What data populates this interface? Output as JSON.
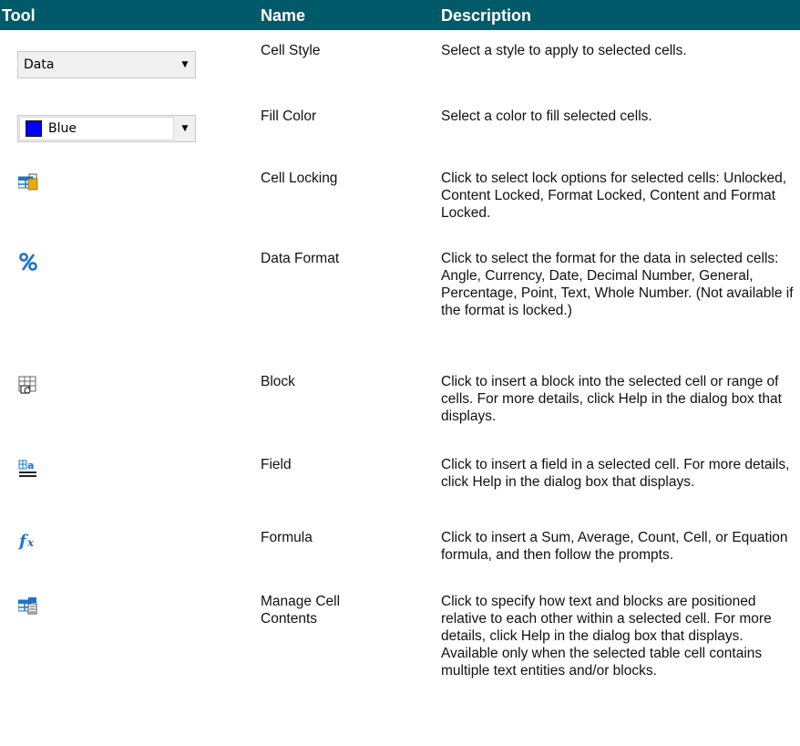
{
  "header": {
    "tool": "Tool",
    "name": "Name",
    "description": "Description"
  },
  "rows": [
    {
      "icon": "cell-style-dropdown",
      "dropdown_value": "Data",
      "name": "Cell Style",
      "description": "Select a style to apply to selected cells."
    },
    {
      "icon": "fill-color-dropdown",
      "dropdown_value": "Blue",
      "swatch_color": "#0000ff",
      "name": "Fill Color",
      "description": "Select a color to fill selected cells."
    },
    {
      "icon": "cell-locking-icon",
      "name": "Cell Locking",
      "description": "Click to select lock options for selected cells: Unlocked, Content Locked, Format Locked, Content and Format Locked."
    },
    {
      "icon": "percent-icon",
      "name": "Data Format",
      "description": "Click to select the format for the data in selected cells: Angle, Currency, Date, Decimal Number, General, Percentage, Point, Text, Whole Number. (Not available if the format is locked.)"
    },
    {
      "icon": "insert-block-icon",
      "name": "Block",
      "description": "Click to insert a block into the selected cell or range of cells. For more details, click Help in the dialog box that displays."
    },
    {
      "icon": "insert-field-icon",
      "name": "Field",
      "description": "Click to insert a field in a selected cell. For more details, click Help in the dialog box that displays."
    },
    {
      "icon": "formula-icon",
      "name": "Formula",
      "description": "Click to insert a Sum, Average, Count, Cell, or Equation formula, and then follow the prompts."
    },
    {
      "icon": "manage-cell-contents-icon",
      "name": "Manage Cell Contents",
      "description": "Click to specify how text and blocks are positioned relative to each other within a selected cell. For more details, click Help in the dialog box that displays. Available only when the selected table cell contains multiple text entities and/or blocks."
    }
  ],
  "colors": {
    "header_bg": "#005a69",
    "icon_blue": "#1e73c8",
    "icon_gold": "#e6a817"
  }
}
